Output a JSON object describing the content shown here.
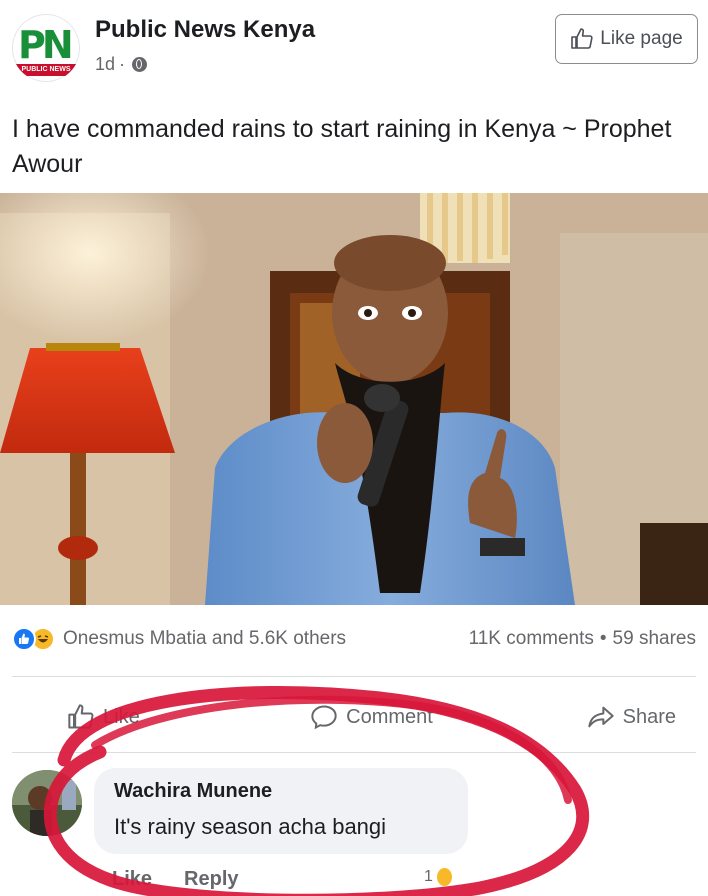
{
  "post": {
    "page_name": "Public News Kenya",
    "avatar_letters": "PN",
    "avatar_ribbon": "PUBLIC NEWS",
    "time": "1d",
    "separator": "·",
    "like_page_label": "Like page",
    "text": "I have commanded rains to start raining in Kenya ~ Prophet Awour"
  },
  "reactions": {
    "names": "Onesmus Mbatia and 5.6K others",
    "comments": "11K comments",
    "dot": "•",
    "shares": "59 shares"
  },
  "actions": {
    "like": "Like",
    "comment": "Comment",
    "share": "Share"
  },
  "comment": {
    "author": "Wachira Munene",
    "text": "It's rainy season acha bangi",
    "like": "Like",
    "reply": "Reply",
    "reaction_count": "1"
  },
  "colors": {
    "text": "#1c1e21",
    "muted": "#65676b",
    "like_blue": "#1877f2",
    "haha_yellow": "#f7b928",
    "annotation_red": "#d8163a",
    "bubble": "#f0f2f5"
  },
  "icons": [
    "globe-icon",
    "thumbs-up-icon",
    "comment-icon",
    "share-icon",
    "like-reaction-icon",
    "haha-reaction-icon"
  ]
}
